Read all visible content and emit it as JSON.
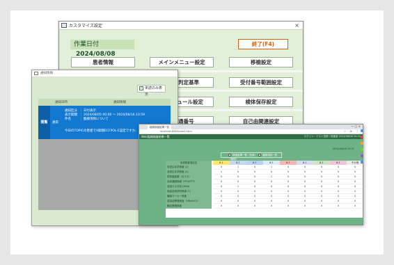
{
  "windowA": {
    "title": "カスタマイズ設定",
    "close": "×",
    "date_label": "作業日付",
    "date_value": "2024/08/08",
    "end_button": "終了(F4)",
    "buttons": {
      "patient_info": "患者情報",
      "main_menu": "メインメニュー設定",
      "transfer": "移檢設定",
      "criteria_partial": "）判定基準",
      "reception_range": "受付番号範囲設定",
      "schedule_partial": "ジュール設定",
      "specimen_save": "検体保存設定",
      "serial_partial": "通番号",
      "free_related": "自己由関連設定"
    }
  },
  "windowB": {
    "title": "通知情報",
    "checkbox_label": "未読のみ表示",
    "checkbox_mark": "✓",
    "col_date": "通知日時",
    "col_info": "通知情報",
    "row": {
      "date": "閲覧",
      "who": "通常",
      "line1": "通知区分　：日付表示",
      "line2": "表示期間　：2024/08/05 00:00 〜 2024/08/16 23:59",
      "line3": "件名　　　：臨検項目について",
      "line4": "今日のTOPICの患者でA期間ECFPOL-E設定ですか、画"
    }
  },
  "windowC": {
    "tab_label": "臨検検査結果一覧",
    "window_controls": "— ▢ ✕",
    "address": "localhost:8080/index.html",
    "tools": "☆ ⊕ ⋮",
    "app_title": "Web臨検検査結果一覧",
    "user_info": "ログイン：テスト技師 / 検査部 2024/08/08 10:31",
    "datetime": "2024/08/08 10:31",
    "filter": {
      "opt1": "検査結果一覧（全体）",
      "opt2": "臨検項目一覧（個別）"
    },
    "table": {
      "name_header": "血液検査項目名",
      "columns": [
        "8:1",
        "8:1",
        "8:1",
        "8:1",
        "8:1",
        "8:1",
        "8:1",
        "8:1",
        "その他"
      ],
      "column_colors": [
        "#ffe66b",
        "#c7d9f0",
        "#b9d4f2",
        "#dce9f7",
        "#f3b5b5",
        "#d9d9f2",
        "#cde3c3",
        "#f2c4d9",
        "#e9e9e9"
      ],
      "rows": [
        {
          "name": "血液生化学検査 (1)",
          "values": [
            "0",
            "1",
            "0",
            "1",
            "0",
            "0",
            "0",
            "0",
            "0"
          ]
        },
        {
          "name": "血液生化学検査 (2)",
          "values": [
            "1",
            "0",
            "0",
            "0",
            "0",
            "0",
            "0",
            "0",
            "0"
          ]
        },
        {
          "name": "尿検査結果（ガラス）",
          "values": [
            "0",
            "0",
            "0",
            "1",
            "0",
            "0",
            "0",
            "0",
            "0"
          ]
        },
        {
          "name": "血液凝固検査（PT/APTT）",
          "values": [
            "0",
            "0",
            "0",
            "0",
            "0",
            "0",
            "0",
            "0",
            "0"
          ]
        },
        {
          "name": "血液ガス分析 (BGA)",
          "values": [
            "0",
            "1",
            "0",
            "0",
            "0",
            "0",
            "0",
            "0",
            "0"
          ]
        },
        {
          "name": "免疫血清学的検査 (1)",
          "values": [
            "0",
            "0",
            "0",
            "0",
            "0",
            "0",
            "0",
            "0",
            "0"
          ]
        },
        {
          "name": "腫瘍マーカー検査",
          "values": [
            "0",
            "0",
            "0",
            "0",
            "0",
            "0",
            "0",
            "0",
            "0"
          ]
        },
        {
          "name": "感染症関連検査（HBs/HCV）",
          "values": [
            "0",
            "0",
            "0",
            "0",
            "0",
            "0",
            "0",
            "0",
            "0"
          ]
        },
        {
          "name": "輸血関連検査",
          "values": [
            "0",
            "0",
            "0",
            "0",
            "0",
            "0",
            "0",
            "0",
            "0"
          ]
        }
      ]
    },
    "side_icon_colors": [
      "#4a90e2",
      "#e74c3c",
      "#f5a623",
      "#7ed321",
      "#9b59b6",
      "#4a90e2"
    ]
  }
}
